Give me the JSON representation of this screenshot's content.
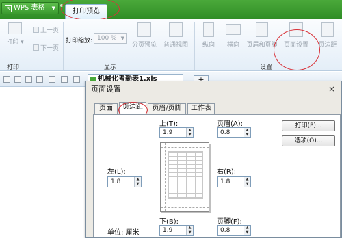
{
  "titlebar": {
    "app_name": "WPS 表格",
    "app_logo": "S",
    "active_tab": "打印预览"
  },
  "ribbon": {
    "print_label": "打印",
    "prev_page": "上一页",
    "next_page": "下一页",
    "zoom_label": "打印缩放:",
    "zoom_value": "100 %",
    "page_break_preview": "分页预览",
    "normal_view": "普通视图",
    "portrait": "纵向",
    "landscape": "横向",
    "header_footer": "页眉和页脚",
    "page_setup": "页面设置",
    "margins": "页边距",
    "group_print": "打印",
    "group_display": "显示",
    "group_settings": "设置"
  },
  "toolbar": {
    "doc_tab": "机械化考勤表1.xls",
    "plus": "+"
  },
  "dialog": {
    "title": "页面设置",
    "close": "×",
    "tabs": [
      "页面",
      "页边距",
      "页眉/页脚",
      "工作表"
    ],
    "top_label": "上(T):",
    "top_value": "1.9",
    "header_label": "页眉(A):",
    "header_value": "0.8",
    "left_label": "左(L):",
    "left_value": "1.8",
    "right_label": "右(R):",
    "right_value": "1.8",
    "bottom_label": "下(B):",
    "bottom_value": "1.9",
    "footer_label": "页脚(F):",
    "footer_value": "0.8",
    "unit_label": "单位: 厘米",
    "print_button": "打印(P)...",
    "options_button": "选项(O)..."
  },
  "colors": {
    "title_green": "#3b9a2f",
    "annotation_red": "#d9333a",
    "ribbon_blue": "#e4eef8"
  }
}
